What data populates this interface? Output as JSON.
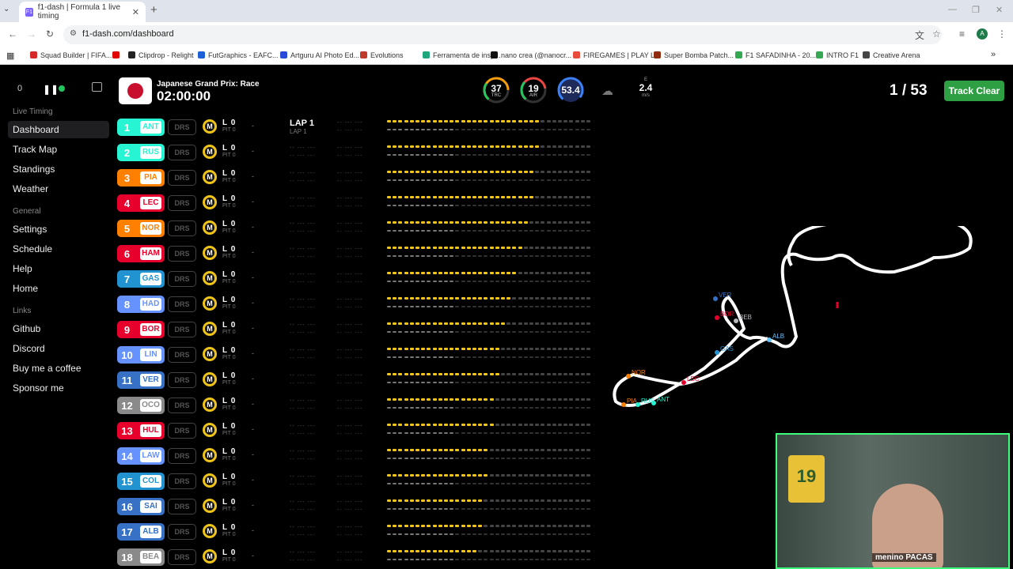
{
  "browser": {
    "tab_title": "f1-dash | Formula 1 live timing",
    "tab_favicon": "F1",
    "url": "f1-dash.com/dashboard",
    "profile_initial": "A",
    "bookmarks": [
      {
        "label": "Squad Builder | FIFA...",
        "color": "#d62828"
      },
      {
        "label": "",
        "color": "#e00000"
      },
      {
        "label": "Clipdrop - Relight",
        "color": "#222222"
      },
      {
        "label": "FutGraphics - EAFC...",
        "color": "#1c5fd6"
      },
      {
        "label": "Artguru AI Photo Ed...",
        "color": "#2a4bd7"
      },
      {
        "label": "Evolutions",
        "color": "#c0392b"
      },
      {
        "label": "Ferramenta de insp...",
        "color": "#1fa67a"
      },
      {
        "label": "nano crea (@nanocr...",
        "color": "#111111"
      },
      {
        "label": "FIREGAMES | PLAY L...",
        "color": "#e74c3c"
      },
      {
        "label": "Super Bomba Patch...",
        "color": "#8e2c0f"
      },
      {
        "label": "F1 SAFADINHA - 20...",
        "color": "#34a853"
      },
      {
        "label": "INTRO F1",
        "color": "#34a853"
      },
      {
        "label": "Creative Arena",
        "color": "#444444"
      }
    ]
  },
  "controls": {
    "delay": "0"
  },
  "sidebar": {
    "sections": [
      {
        "header": "Live Timing",
        "items": [
          "Dashboard",
          "Track Map",
          "Standings",
          "Weather"
        ]
      },
      {
        "header": "General",
        "items": [
          "Settings",
          "Schedule",
          "Help",
          "Home"
        ]
      },
      {
        "header": "Links",
        "items": [
          "Github",
          "Discord",
          "Buy me a coffee",
          "Sponsor me"
        ]
      }
    ]
  },
  "header": {
    "race_name": "Japanese Grand Prix: Race",
    "session_clock": "02:00:00",
    "weather": {
      "track_temp": "37",
      "track_label": "TRC",
      "air_temp": "19",
      "air_label": "AIR",
      "humidity": "53.4",
      "wind_direction": "E",
      "wind_speed": "2.4",
      "wind_unit": "m/s"
    },
    "laps": "1 / 53",
    "track_status": "Track Clear"
  },
  "timing": {
    "drs_label": "DRS",
    "tyre": "M",
    "lap_label": "L 0",
    "pit_label": "PIT 0",
    "gap": "-",
    "leader_lap": "LAP 1",
    "leader_sub": "LAP 1",
    "dashes": "-- --- --- ",
    "drivers": [
      {
        "pos": "1",
        "tla": "ANT",
        "color": "#27f4d2",
        "done": 27
      },
      {
        "pos": "2",
        "tla": "RUS",
        "color": "#27f4d2",
        "done": 27
      },
      {
        "pos": "3",
        "tla": "PIA",
        "color": "#ff8000",
        "done": 26
      },
      {
        "pos": "4",
        "tla": "LEC",
        "color": "#e8002d",
        "done": 26
      },
      {
        "pos": "5",
        "tla": "NOR",
        "color": "#ff8000",
        "done": 25
      },
      {
        "pos": "6",
        "tla": "HAM",
        "color": "#e8002d",
        "done": 24
      },
      {
        "pos": "7",
        "tla": "GAS",
        "color": "#2293d1",
        "done": 23
      },
      {
        "pos": "8",
        "tla": "HAD",
        "color": "#6692ff",
        "done": 22
      },
      {
        "pos": "9",
        "tla": "BOR",
        "color": "#e8002d",
        "done": 21
      },
      {
        "pos": "10",
        "tla": "LIN",
        "color": "#6692ff",
        "done": 20
      },
      {
        "pos": "11",
        "tla": "VER",
        "color": "#3671c6",
        "done": 20
      },
      {
        "pos": "12",
        "tla": "OCO",
        "color": "#8a8a8a",
        "done": 19
      },
      {
        "pos": "13",
        "tla": "HUL",
        "color": "#e8002d",
        "done": 19
      },
      {
        "pos": "14",
        "tla": "LAW",
        "color": "#6692ff",
        "done": 18
      },
      {
        "pos": "15",
        "tla": "COL",
        "color": "#2293d1",
        "done": 18
      },
      {
        "pos": "16",
        "tla": "SAI",
        "color": "#3671c6",
        "done": 17
      },
      {
        "pos": "17",
        "tla": "ALB",
        "color": "#3671c6",
        "done": 17
      },
      {
        "pos": "18",
        "tla": "BEA",
        "color": "#8a8a8a",
        "done": 16
      }
    ]
  },
  "map": {
    "labels": [
      {
        "tla": "VER",
        "color": "#3671c6"
      },
      {
        "tla": "BOR",
        "color": "#e8002d"
      },
      {
        "tla": "BEB",
        "color": "#b6babd"
      },
      {
        "tla": "ALB",
        "color": "#64c4ff"
      },
      {
        "tla": "GAS",
        "color": "#2293d1"
      },
      {
        "tla": "NOR",
        "color": "#ff8000"
      },
      {
        "tla": "LEC",
        "color": "#e8002d"
      },
      {
        "tla": "PIA",
        "color": "#ff8000"
      },
      {
        "tla": "RUS",
        "color": "#27f4d2"
      },
      {
        "tla": "ANT",
        "color": "#27f4d2"
      }
    ]
  },
  "webcam": {
    "shirt_number": "19",
    "overlay_tag": "menino PACAS"
  }
}
